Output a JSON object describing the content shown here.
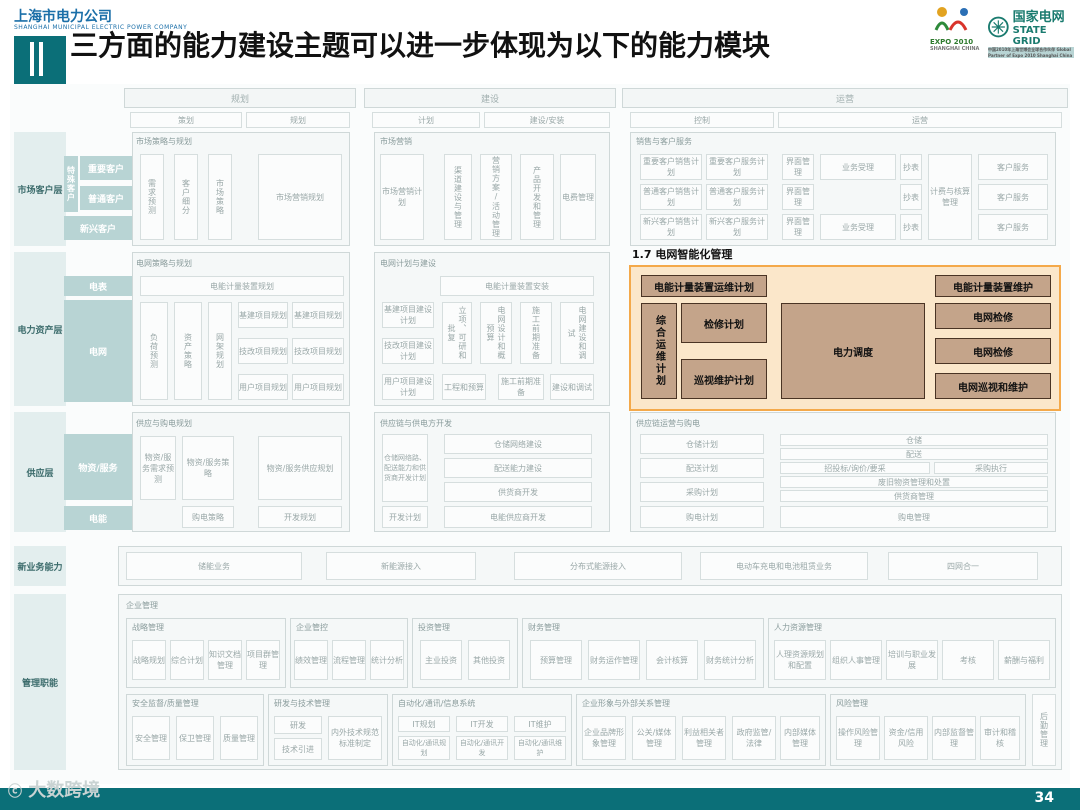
{
  "header": {
    "company_cn": "上海市电力公司",
    "company_en": "SHANGHAI MUNICIPAL ELECTRIC POWER COMPANY",
    "title": "三方面的能力建设主题可以进一步体现为以下的能力模块",
    "expo_text": "EXPO 2010",
    "expo_sub": "SHANGHAI CHINA",
    "sg_cn": "国家电网",
    "sg_en": "STATE GRID",
    "sg_sub": "中国2010年上海世博会全球合作伙伴 Global Partner of Expo 2010 Shanghai China"
  },
  "phases": {
    "plan": "规划",
    "plan_sub": [
      "策划",
      "规划"
    ],
    "build": "建设",
    "build_sub": [
      "计划",
      "建设/安装"
    ],
    "operate": "运营",
    "operate_sub": [
      "控制",
      "运营"
    ]
  },
  "lanes": [
    "市场客户层",
    "电力资产层",
    "供应层",
    "新业务能力",
    "管理职能"
  ],
  "sublanes": {
    "market": [
      "特殊客户",
      "重要客户",
      "普通客户",
      "新兴客户"
    ],
    "asset": [
      "电表",
      "电网"
    ],
    "supply": [
      "物资/服务",
      "电能"
    ]
  },
  "market_row": {
    "plan_title": "市场策略与规划",
    "plan_items": [
      "需求预测",
      "客户细分",
      "市场策略",
      "市场营销规划"
    ],
    "build_title": "市场营销",
    "build_items": [
      "市场营销计划",
      "渠道建设与管理",
      "营销方案/活动管理",
      "产品开发和管理",
      "电费管理"
    ],
    "op_title": "销售与客户服务",
    "op_items": [
      "重要客户销售计划",
      "重要客户服务计划",
      "界面管理",
      "业务受理",
      "抄表",
      "计费与核算管理",
      "客户服务",
      "普通客户销售计划",
      "普通客户服务计划",
      "新兴客户销售计划",
      "新兴客户服务计划"
    ]
  },
  "asset_row": {
    "plan_title": "电网策略与规划",
    "plan_items": [
      "电能计量装置规划",
      "负荷预测",
      "资产策略",
      "网架规划",
      "基建项目规划",
      "技改项目规划",
      "用户项目规划"
    ],
    "build_title": "电网计划与建设",
    "build_items": [
      "电能计量装置安装",
      "基建项目建设计划",
      "技改项目建设计划",
      "用户项目建设计划",
      "立项、可研和批复",
      "电网设计和概预算",
      "施工前期准备",
      "电网建设和调试",
      "工程和预算",
      "施工前期准备",
      "建设和调试"
    ]
  },
  "highlight": {
    "label": "1.7 电网智能化管理",
    "meter_ops_plan": "电能计量装置运维计划",
    "integrated_ops": "综合运维计划",
    "maint_plan": "检修计划",
    "patrol_plan": "巡视维护计划",
    "dispatch": "电力调度",
    "meter_maint": "电能计量装置维护",
    "grid_repair_1": "电网检修",
    "grid_repair_2": "电网检修",
    "grid_patrol": "电网巡视和维护"
  },
  "supply_row": {
    "plan_title": "供应与购电规划",
    "plan_items": [
      "物资/服务需求预测",
      "物资/服务策略",
      "物资/服务供应规划",
      "购电策略",
      "开发规划"
    ],
    "build_title": "供应链与供电方开发",
    "build_items": [
      "仓储网络路、配送能力和供货商开发计划",
      "仓储网络建设",
      "配送能力建设",
      "供货商开发",
      "开发计划",
      "电能供应商开发"
    ],
    "op_title": "供应链运营与购电",
    "op_items": [
      "仓储计划",
      "配送计划",
      "采购计划",
      "购电计划",
      "仓储",
      "配送",
      "招投标/询价/要采",
      "采购执行",
      "废旧物资管理和处置",
      "供货商管理",
      "购电管理"
    ]
  },
  "new_biz": [
    "储能业务",
    "新能源接入",
    "分布式能源接入",
    "电动车充电和电池租赁业务",
    "四网合一"
  ],
  "mgmt": {
    "title": "企业管理",
    "groups": [
      {
        "title": "战略管理",
        "items": [
          "战略规划",
          "综合计划",
          "知识文档管理",
          "项目群管理"
        ]
      },
      {
        "title": "企业管控",
        "items": [
          "绩效管理",
          "流程管理",
          "统计分析"
        ]
      },
      {
        "title": "投资管理",
        "items": [
          "主业投资",
          "其他投资"
        ]
      },
      {
        "title": "财务管理",
        "items": [
          "预算管理",
          "财务运作管理",
          "会计核算",
          "财务统计分析"
        ]
      },
      {
        "title": "人力资源管理",
        "items": [
          "人理资源规划和配置",
          "组织人事管理",
          "培训与职业发展",
          "考核",
          "薪酬与福利"
        ]
      },
      {
        "title": "安全监督/质量管理",
        "items": [
          "安全管理",
          "保卫管理",
          "质量管理"
        ]
      },
      {
        "title": "研发与技术管理",
        "items": [
          "研发",
          "技术引进",
          "内外技术规范标准制定"
        ]
      },
      {
        "title": "自动化/通讯/信息系统",
        "items": [
          "IT规划",
          "IT开发",
          "IT维护",
          "自动化/通讯规划",
          "自动化/通讯开发",
          "自动化/通讯维护"
        ]
      },
      {
        "title": "企业形象与外部关系管理",
        "items": [
          "企业品牌形象管理",
          "公关/媒体管理",
          "利益相关者管理",
          "政府监管/法律",
          "内部媒体管理"
        ]
      },
      {
        "title": "风险管理",
        "items": [
          "操作风险管理",
          "资金/信用风险",
          "内部监督管理",
          "审计和稽核"
        ]
      },
      {
        "title": "",
        "items": [
          "后勤管理"
        ]
      }
    ]
  },
  "footer": {
    "page": "34",
    "watermark": "大数跨境"
  }
}
